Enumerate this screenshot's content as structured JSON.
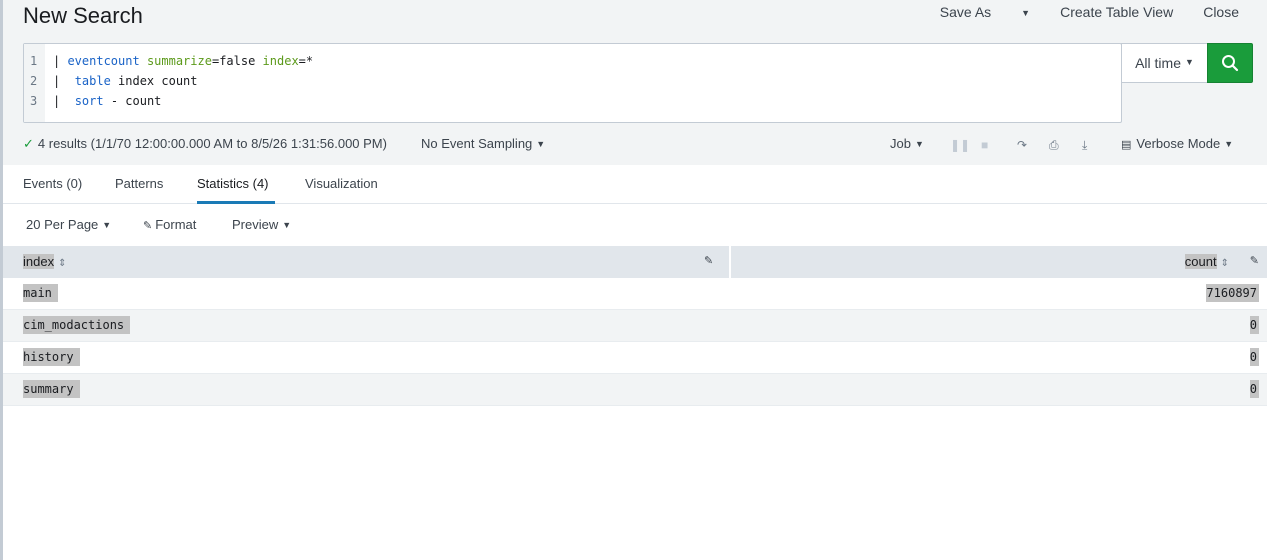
{
  "header": {
    "title": "New Search",
    "save_as": "Save As",
    "create_table_view": "Create Table View",
    "close": "Close"
  },
  "search": {
    "line_numbers": [
      "1",
      "2",
      "3"
    ],
    "line1": {
      "pipe": "| ",
      "command": "eventcount",
      "sp": " ",
      "arg1": "summarize",
      "val1": "=false ",
      "arg2": "index",
      "val2": "=*"
    },
    "line2": {
      "pipe": "|  ",
      "command": "table",
      "rest": " index count"
    },
    "line3": {
      "pipe": "|  ",
      "command": "sort",
      "rest": " - count"
    },
    "time_range": "All time",
    "search_icon": "search-icon"
  },
  "status": {
    "check_icon": "check-icon",
    "results_text": "4 results (1/1/70 12:00:00.000 AM to 8/5/26 1:31:56.000 PM)",
    "sampling": "No Event Sampling",
    "job": "Job",
    "mode": "Verbose Mode"
  },
  "tabs": [
    {
      "label": "Events (0)",
      "active": false
    },
    {
      "label": "Patterns",
      "active": false
    },
    {
      "label": "Statistics (4)",
      "active": true
    },
    {
      "label": "Visualization",
      "active": false
    }
  ],
  "toolbar": {
    "per_page": "20 Per Page",
    "format": "Format",
    "preview": "Preview"
  },
  "table": {
    "columns": [
      "index",
      "count"
    ],
    "rows": [
      {
        "index": "main",
        "count": "7160897"
      },
      {
        "index": "cim_modactions",
        "count": "0"
      },
      {
        "index": "history",
        "count": "0"
      },
      {
        "index": "summary",
        "count": "0"
      }
    ]
  },
  "colors": {
    "accent_green": "#1a9c3b",
    "tab_underline": "#1a7ab6",
    "keyword_blue": "#1a63c7",
    "argument_green": "#5c9a1b"
  }
}
